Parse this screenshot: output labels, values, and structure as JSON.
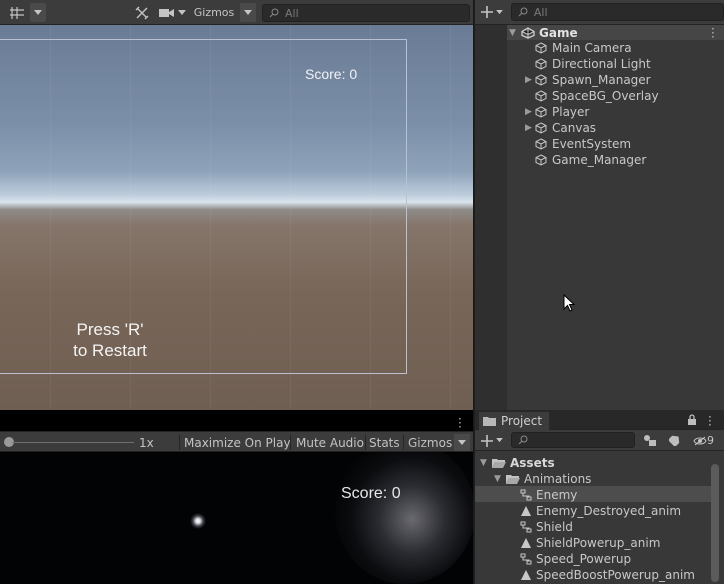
{
  "scene_view": {
    "toolbar": {
      "grid_tool_icon": "grid-snap-icon",
      "tools_icon": "tools-icon",
      "camera_icon": "camera-icon",
      "gizmos_label": "Gizmos",
      "search_placeholder": "All"
    },
    "score_text": "Score:  0",
    "restart_line1": "Press 'R'",
    "restart_line2": "to Restart"
  },
  "hierarchy": {
    "search_placeholder": "All",
    "scene_name": "Game",
    "items": [
      {
        "label": "Main Camera",
        "expandable": false
      },
      {
        "label": "Directional Light",
        "expandable": false
      },
      {
        "label": "Spawn_Manager",
        "expandable": true
      },
      {
        "label": "SpaceBG_Overlay",
        "expandable": false
      },
      {
        "label": "Player",
        "expandable": true
      },
      {
        "label": "Canvas",
        "expandable": true
      },
      {
        "label": "EventSystem",
        "expandable": false
      },
      {
        "label": "Game_Manager",
        "expandable": false
      }
    ]
  },
  "game_view": {
    "toolbar": {
      "scale_label": "1x",
      "maximize_label": "Maximize On Play",
      "mute_label": "Mute Audio",
      "stats_label": "Stats",
      "gizmos_label": "Gizmos"
    },
    "score_text": "Score:  0"
  },
  "project": {
    "tab_label": "Project",
    "hidden_count": "9",
    "tree": {
      "assets_label": "Assets",
      "animations_label": "Animations",
      "items": [
        {
          "label": "Enemy",
          "type": "animator-controller",
          "selected": true
        },
        {
          "label": "Enemy_Destroyed_anim",
          "type": "animation-clip",
          "selected": false
        },
        {
          "label": "Shield",
          "type": "animator-controller",
          "selected": false
        },
        {
          "label": "ShieldPowerup_anim",
          "type": "animation-clip",
          "selected": false
        },
        {
          "label": "Speed_Powerup",
          "type": "animator-controller",
          "selected": false
        },
        {
          "label": "SpeedBoostPowerup_anim",
          "type": "animation-clip",
          "selected": false
        }
      ]
    }
  },
  "colors": {
    "panel_bg": "#383838",
    "toolbar_bg": "#3c3c3c",
    "selected_row": "#4d4d4d",
    "scene_ground": "#786658",
    "scene_sky": "#7b8ea8"
  }
}
